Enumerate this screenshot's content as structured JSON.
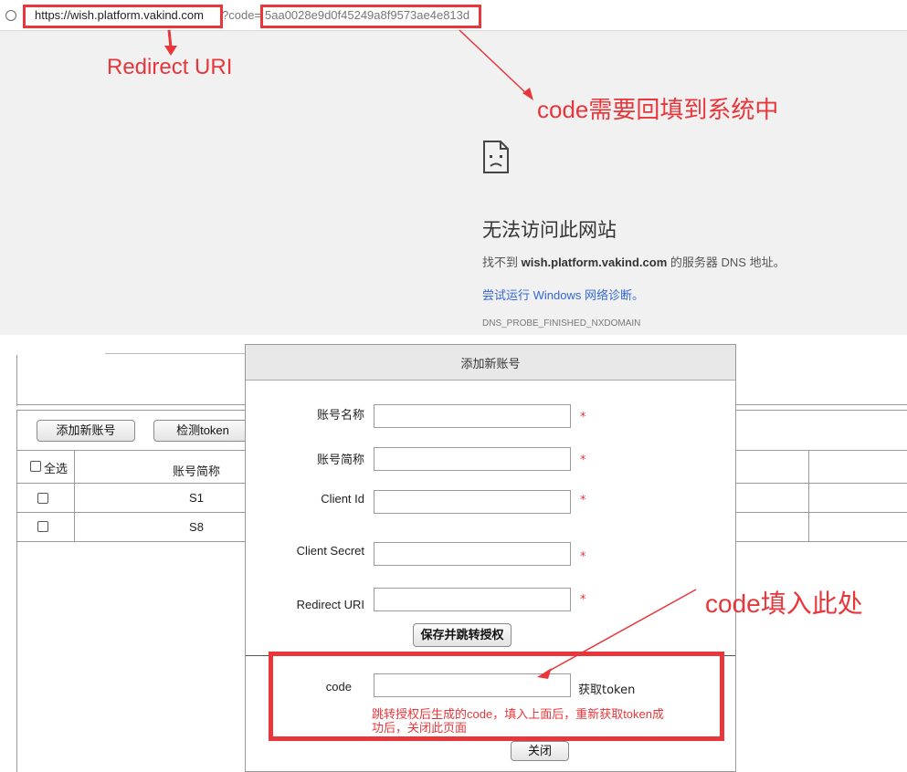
{
  "browser": {
    "url_host": "https://wish.platform.vakind.com",
    "url_query": "?code=",
    "url_code": "5aa0028e9d0f45249a8f9573ae4e813d",
    "error_title": "无法访问此网站",
    "error_desc_prefix": "找不到 ",
    "error_desc_host": "wish.platform.vakind.com",
    "error_desc_suffix": " 的服务器 DNS 地址。",
    "error_link": "尝试运行 Windows 网络诊断。",
    "error_code": "DNS_PROBE_FINISHED_NXDOMAIN"
  },
  "annotations": {
    "redirect_uri": "Redirect URI",
    "code_fill_back": "code需要回填到系统中",
    "code_fill_here": "code填入此处",
    "color": "#e8363a"
  },
  "toolbar": {
    "add_account": "添加新账号",
    "check_token": "检测token"
  },
  "table": {
    "select_all": "全选",
    "header_short_name": "账号简称",
    "rows": [
      {
        "short_name": "S1"
      },
      {
        "short_name": "S8"
      }
    ]
  },
  "modal": {
    "title": "添加新账号",
    "fields": {
      "account_name": "账号名称",
      "account_short_name": "账号简称",
      "client_id": "Client Id",
      "client_secret": "Client Secret",
      "redirect_uri": "Redirect URI",
      "required_mark": "*"
    },
    "save_button": "保存并跳转授权",
    "code_label": "code",
    "get_token": "获取token",
    "hint": "跳转授权后生成的code，填入上面后，重新获取token成功后，关闭此页面",
    "close_button": "关闭"
  },
  "icons": {
    "info": "info-circle-icon",
    "sad_page": "sad-page-icon"
  }
}
